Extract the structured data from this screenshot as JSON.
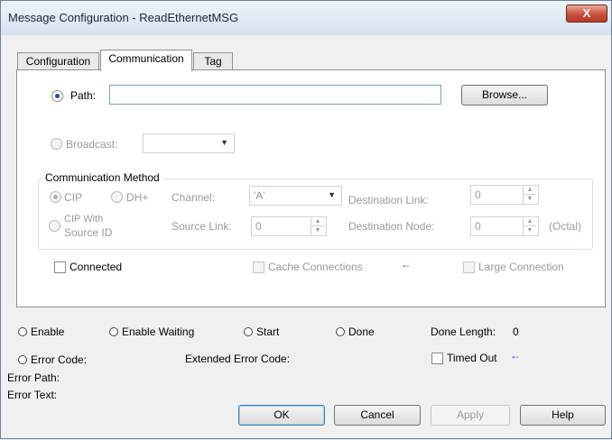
{
  "window": {
    "title": "Message Configuration - ReadEthernetMSG",
    "close_label": "X"
  },
  "tabs": [
    {
      "label": "Configuration"
    },
    {
      "label": "Communication"
    },
    {
      "label": "Tag"
    }
  ],
  "path": {
    "label": "Path:",
    "value": "",
    "browse_label": "Browse..."
  },
  "broadcast": {
    "label": "Broadcast:",
    "value": ""
  },
  "comm_method": {
    "title": "Communication Method",
    "cip_label": "CIP",
    "dh_label": "DH+",
    "channel_label": "Channel:",
    "channel_value": "'A'",
    "dest_link_label": "Destination Link:",
    "dest_link_value": "0",
    "cip_source_label_1": "CIP With",
    "cip_source_label_2": "Source ID",
    "source_link_label": "Source Link:",
    "source_link_value": "0",
    "dest_node_label": "Destination Node:",
    "dest_node_value": "0",
    "octal_label": "(Octal)"
  },
  "options": {
    "connected_label": "Connected",
    "cache_label": "Cache Connections",
    "large_label": "Large Connection",
    "arrow": "←"
  },
  "status": {
    "enable": "Enable",
    "enable_waiting": "Enable Waiting",
    "start": "Start",
    "done": "Done",
    "done_length_label": "Done Length:",
    "done_length_value": "0",
    "error_code": "Error Code:",
    "extended_error": "Extended Error Code:",
    "timed_out": "Timed Out",
    "error_path": "Error Path:",
    "error_text": "Error Text:"
  },
  "buttons": {
    "ok": "OK",
    "cancel": "Cancel",
    "apply": "Apply",
    "help": "Help"
  }
}
